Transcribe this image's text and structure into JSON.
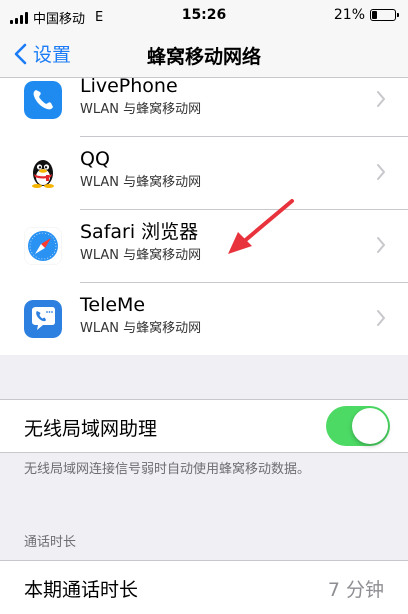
{
  "status_bar": {
    "carrier": "中国移动",
    "network": "E",
    "time": "15:26",
    "battery": "21%",
    "battery_level": 0.21
  },
  "nav": {
    "back_label": "设置",
    "title": "蜂窝移动网络"
  },
  "apps": [
    {
      "name": "LivePhone",
      "access": "WLAN 与蜂窝移动网",
      "icon": "phone-app-icon"
    },
    {
      "name": "QQ",
      "access": "WLAN 与蜂窝移动网",
      "icon": "qq-penguin-icon"
    },
    {
      "name": "Safari 浏览器",
      "access": "WLAN 与蜂窝移动网",
      "icon": "safari-compass-icon"
    },
    {
      "name": "TeleMe",
      "access": "WLAN 与蜂窝移动网",
      "icon": "teleme-phone-bubble-icon"
    }
  ],
  "wifi_assist": {
    "label": "无线局域网助理",
    "enabled": true,
    "footnote": "无线局域网连接信号弱时自动使用蜂窝移动数据。"
  },
  "call_time": {
    "section_header": "通话时长",
    "label": "本期通话时长",
    "value": "7 分钟"
  },
  "annotation": {
    "color": "#e8323c"
  },
  "colors": {
    "accent": "#1b7cf6",
    "toggle_on": "#4cd964",
    "background": "#efeff4"
  }
}
